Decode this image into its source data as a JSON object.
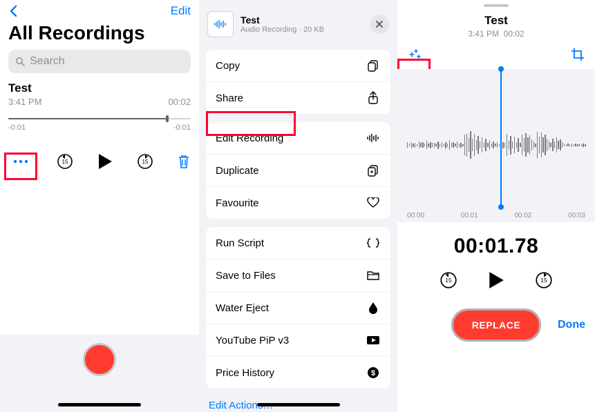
{
  "screen1": {
    "edit_label": "Edit",
    "page_title": "All Recordings",
    "search_placeholder": "Search",
    "recording": {
      "title": "Test",
      "time": "3:41 PM",
      "duration": "00:02"
    },
    "track": {
      "left_time": "-0:01",
      "right_time": "-0:01"
    }
  },
  "screen2": {
    "file": {
      "title": "Test",
      "subtitle": "Audio Recording · 20 KB"
    },
    "actions_group1": [
      {
        "label": "Copy",
        "icon": "copy-icon"
      },
      {
        "label": "Share",
        "icon": "share-icon"
      }
    ],
    "actions_group2": [
      {
        "label": "Edit Recording",
        "icon": "waveform-icon"
      },
      {
        "label": "Duplicate",
        "icon": "duplicate-icon"
      },
      {
        "label": "Favourite",
        "icon": "heart-icon"
      }
    ],
    "actions_group3": [
      {
        "label": "Run Script",
        "icon": "braces-icon"
      },
      {
        "label": "Save to Files",
        "icon": "folder-icon"
      },
      {
        "label": "Water Eject",
        "icon": "droplet-icon"
      },
      {
        "label": "YouTube PiP v3",
        "icon": "video-icon"
      },
      {
        "label": "Price History",
        "icon": "dollar-icon"
      }
    ],
    "edit_actions": "Edit Actions…"
  },
  "screen3": {
    "title": "Test",
    "subtitle_time": "3:41 PM",
    "subtitle_duration": "00:02",
    "timemarks": [
      "00:00",
      "00:01",
      "00:02",
      "00:03"
    ],
    "big_time": "00:01.78",
    "replace_label": "REPLACE",
    "done_label": "Done",
    "waveform_heights": [
      8,
      4,
      9,
      5,
      7,
      3,
      10,
      6,
      8,
      4,
      12,
      5,
      9,
      6,
      7,
      4,
      11,
      5,
      8,
      3,
      9,
      5,
      14,
      6,
      8,
      4,
      10,
      5,
      7,
      3,
      30,
      33,
      20,
      40,
      18,
      32,
      15,
      26,
      10,
      22,
      8,
      18,
      6,
      14,
      5,
      10,
      4,
      8,
      3,
      6,
      9,
      7,
      32,
      12,
      27,
      10,
      24,
      8,
      20,
      6,
      30,
      20,
      34,
      22,
      28,
      16,
      10,
      5,
      38,
      24,
      36,
      22,
      30,
      18,
      12,
      6,
      18,
      10,
      22,
      12,
      16,
      8,
      4,
      3,
      4,
      3,
      5,
      3,
      4,
      3,
      4,
      3,
      5,
      3
    ]
  }
}
